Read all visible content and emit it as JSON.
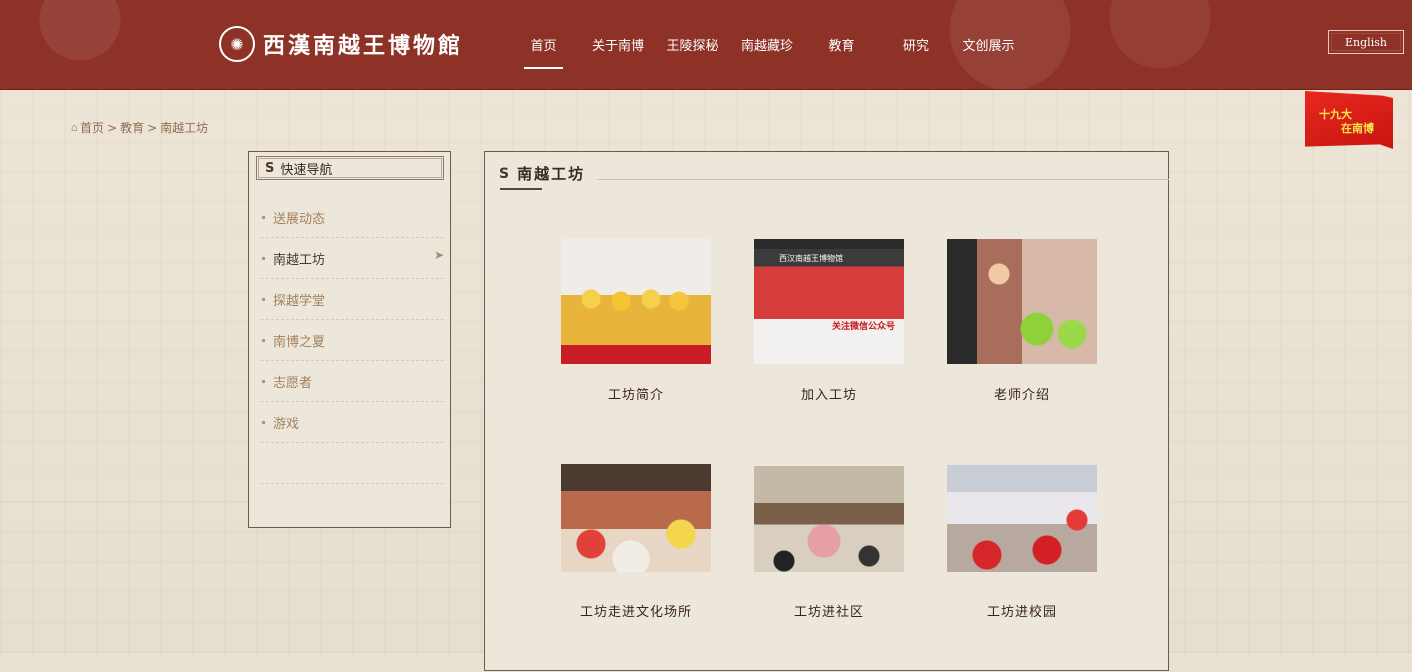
{
  "header": {
    "logo_text": "西漢南越王博物館",
    "nav": [
      "首页",
      "关于南博",
      "王陵探秘",
      "南越藏珍",
      "教育",
      "研究",
      "文创展示"
    ],
    "active_nav": 0,
    "english_label": "English"
  },
  "flag": {
    "line1": "十九大",
    "line2": "在南博"
  },
  "breadcrumb": {
    "home": "首页",
    "level1": "教育",
    "level2": "南越工坊",
    "separator": ">"
  },
  "sidebar": {
    "title": "快速导航",
    "items": [
      {
        "label": "送展动态"
      },
      {
        "label": "南越工坊"
      },
      {
        "label": "探越学堂"
      },
      {
        "label": "南博之夏"
      },
      {
        "label": "志愿者"
      },
      {
        "label": "游戏"
      }
    ],
    "active_index": 1
  },
  "main": {
    "title": "南越工坊",
    "cards": [
      {
        "caption": "工坊简介"
      },
      {
        "caption": "加入工坊",
        "thumb_text_1": "西汉南越王博物馆",
        "thumb_text_2": "关注微信公众号"
      },
      {
        "caption": "老师介绍"
      },
      {
        "caption": "工坊走进文化场所"
      },
      {
        "caption": "工坊进社区"
      },
      {
        "caption": "工坊进校园"
      }
    ]
  },
  "icons": {
    "home": "home-icon",
    "seal": "seal-icon",
    "arrow": "arrow-right-icon"
  },
  "colors": {
    "header_bg": "#8e3227",
    "page_bg": "#e9e1d1",
    "accent_text": "#a3815e"
  }
}
